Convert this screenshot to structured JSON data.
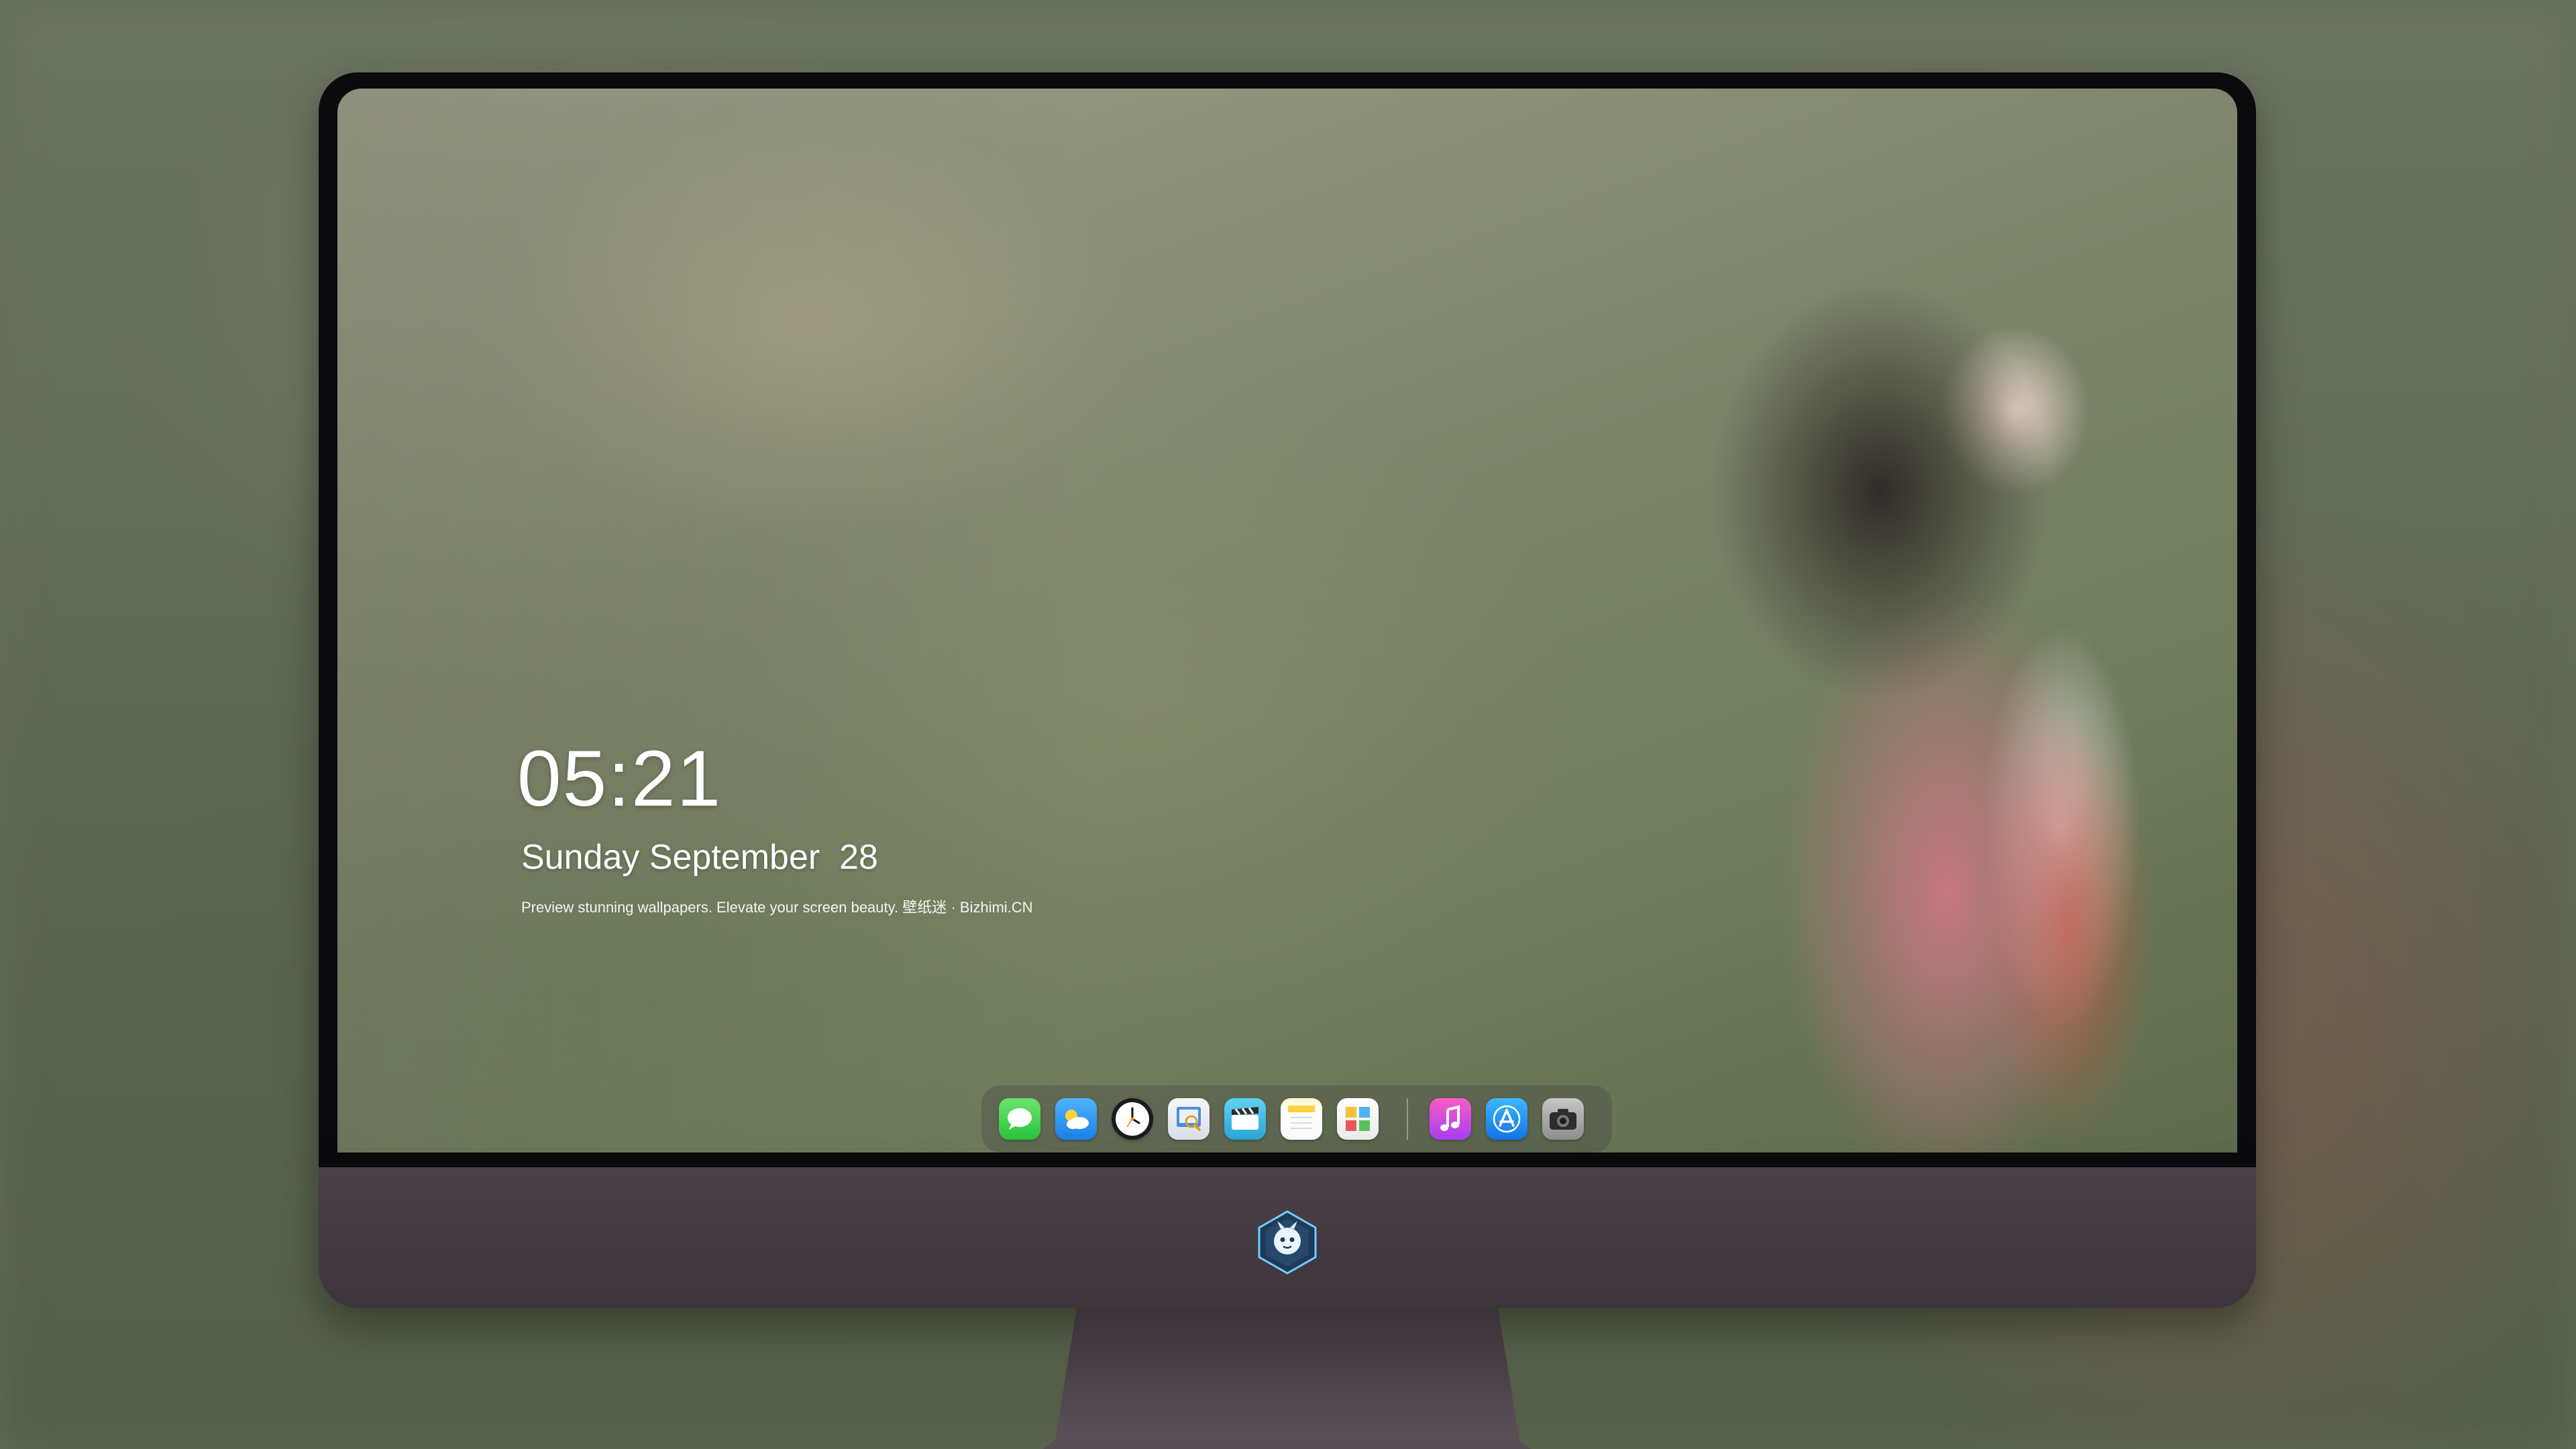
{
  "lock_screen": {
    "time": "05:21",
    "date": "Sunday September  28",
    "tagline": "Preview stunning wallpapers. Elevate your screen beauty. 壁纸迷 · Bizhimi.CN"
  },
  "dock": {
    "apps": [
      {
        "name": "Messages",
        "icon": "messages-icon"
      },
      {
        "name": "Weather",
        "icon": "weather-icon"
      },
      {
        "name": "Clock",
        "icon": "clock-icon"
      },
      {
        "name": "Preview",
        "icon": "preview-icon"
      },
      {
        "name": "Clips",
        "icon": "clapperboard-icon"
      },
      {
        "name": "Notes",
        "icon": "notes-icon"
      },
      {
        "name": "Photos",
        "icon": "photos-icon"
      },
      {
        "name": "Music",
        "icon": "music-note-icon"
      },
      {
        "name": "App Store",
        "icon": "app-store-icon"
      },
      {
        "name": "Camera",
        "icon": "camera-icon"
      }
    ]
  },
  "colors": {
    "bezel": "#0b0a0d",
    "chin": "#3d343c",
    "text": "#ffffff"
  }
}
